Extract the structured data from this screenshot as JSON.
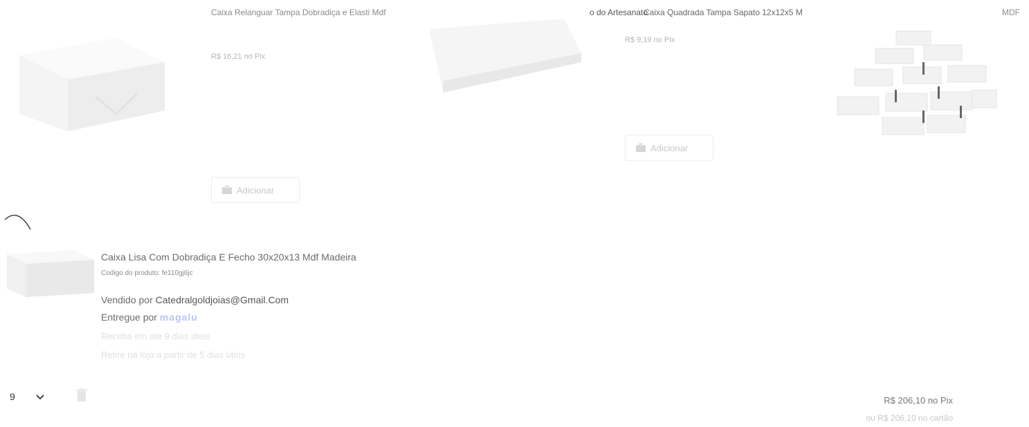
{
  "recommendations": [
    {
      "title": "Caixa Relanguar Tampa Dobradiça e Elasti Mdf",
      "price": "R$ 16,21 no Pix",
      "add_label": "Adicionar"
    },
    {
      "title_overlap": "o do Artesanato",
      "title": "Caixa Quadrada Tampa Sapato 12x12x5 M",
      "price": "R$ 9,19 no Pix",
      "add_label": "Adicionar"
    },
    {
      "title": "MDF"
    }
  ],
  "cart_item": {
    "title": "Caixa Lisa Com Dobradiça E Fecho 30x20x13 Mdf Madeira",
    "code": "Codigo do produto: fe110gj6jc",
    "sold_by_prefix": "Vendido por ",
    "sold_by": "Catedralgoldjoias@Gmail.Com",
    "delivered_by_prefix": "Entregue por ",
    "delivered_by": "magalu",
    "receive": "Receba em até 9 dias úteis",
    "pickup": "Retire na loja a partir de 5 dias úteis",
    "quantity": "9",
    "price_pix": "R$ 206,10 no Pix",
    "price_card": "ou R$ 206,10 no cartão"
  },
  "colors": {
    "magalu_logo": "#b9c4f2",
    "border": "#ececec"
  }
}
